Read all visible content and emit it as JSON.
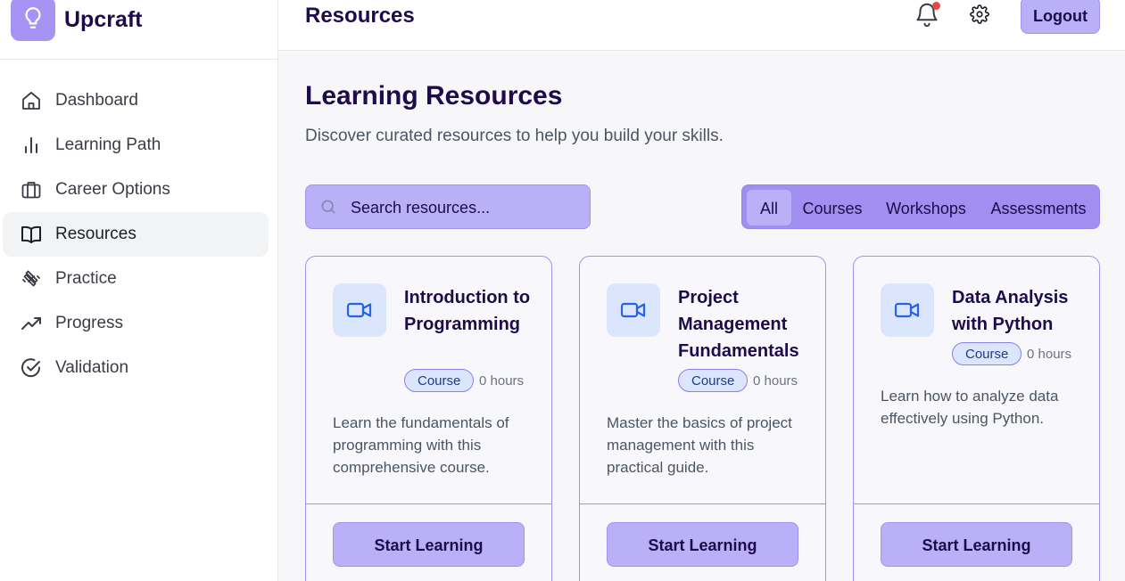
{
  "app": {
    "name": "Upcraft"
  },
  "sidebar": {
    "items": [
      {
        "label": "Dashboard",
        "icon": "home-icon",
        "active": false
      },
      {
        "label": "Learning Path",
        "icon": "bar-chart-icon",
        "active": false
      },
      {
        "label": "Career Options",
        "icon": "briefcase-icon",
        "active": false
      },
      {
        "label": "Resources",
        "icon": "book-open-icon",
        "active": true
      },
      {
        "label": "Practice",
        "icon": "dumbbell-icon",
        "active": false
      },
      {
        "label": "Progress",
        "icon": "trending-up-icon",
        "active": false
      },
      {
        "label": "Validation",
        "icon": "check-circle-icon",
        "active": false
      }
    ]
  },
  "header": {
    "title": "Resources",
    "logout_label": "Logout",
    "has_notification": true
  },
  "page": {
    "title": "Learning Resources",
    "subtitle": "Discover curated resources to help you build your skills."
  },
  "search": {
    "placeholder": "Search resources..."
  },
  "filters": [
    {
      "label": "All",
      "active": true
    },
    {
      "label": "Courses",
      "active": false
    },
    {
      "label": "Workshops",
      "active": false
    },
    {
      "label": "Assessments",
      "active": false
    }
  ],
  "resources": [
    {
      "title": "Introduction to Programming",
      "type": "Course",
      "duration": "0 hours",
      "description": "Learn the fundamentals of programming with this comprehensive course.",
      "button": "Start Learning",
      "icon": "video-icon"
    },
    {
      "title": "Project Management Fundamentals",
      "type": "Course",
      "duration": "0 hours",
      "description": "Master the basics of project management with this practical guide.",
      "button": "Start Learning",
      "icon": "video-icon"
    },
    {
      "title": "Data Analysis with Python",
      "type": "Course",
      "duration": "0 hours",
      "description": "Learn how to analyze data effectively using Python.",
      "button": "Start Learning",
      "icon": "video-icon"
    }
  ],
  "colors": {
    "accent": "#b9b0f8",
    "accent_dark": "#a08ff0",
    "brand_text": "#1d0b4a",
    "icon_blue": "#2563eb",
    "notification": "#ef4444"
  }
}
